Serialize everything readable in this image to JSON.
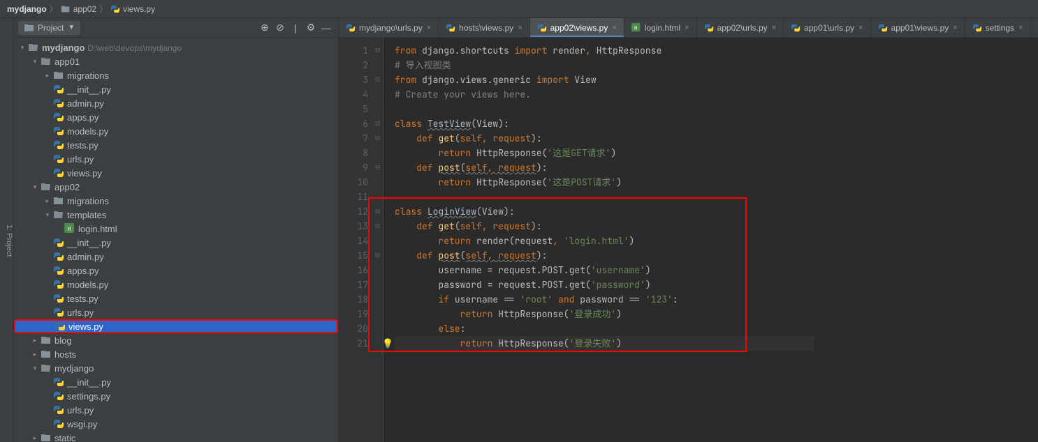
{
  "breadcrumb": {
    "root": "mydjango",
    "mid": "app02",
    "file": "views.py"
  },
  "side_rail": "1: Project",
  "project_panel": {
    "title": "Project",
    "toolbar": {
      "target": "⊕",
      "collapse": "⊘",
      "divider": "|",
      "gear": "⚙",
      "hide": "—"
    }
  },
  "tree": {
    "root": {
      "name": "mydjango",
      "path": "D:\\web\\devops\\mydjango"
    },
    "app01": {
      "name": "app01",
      "migrations": "migrations",
      "files": [
        "__init__.py",
        "admin.py",
        "apps.py",
        "models.py",
        "tests.py",
        "urls.py",
        "views.py"
      ]
    },
    "app02": {
      "name": "app02",
      "migrations": "migrations",
      "templates": "templates",
      "templates_children": [
        "login.html"
      ],
      "files": [
        "__init__.py",
        "admin.py",
        "apps.py",
        "models.py",
        "tests.py",
        "urls.py",
        "views.py"
      ]
    },
    "blog": "blog",
    "hosts": "hosts",
    "mydjango_inner": {
      "name": "mydjango",
      "files": [
        "__init__.py",
        "settings.py",
        "urls.py",
        "wsgi.py"
      ]
    },
    "static": "static"
  },
  "tabs": [
    {
      "label": "mydjango\\urls.py",
      "type": "py"
    },
    {
      "label": "hosts\\views.py",
      "type": "py"
    },
    {
      "label": "app02\\views.py",
      "type": "py",
      "active": true
    },
    {
      "label": "login.html",
      "type": "html"
    },
    {
      "label": "app02\\urls.py",
      "type": "py"
    },
    {
      "label": "app01\\urls.py",
      "type": "py"
    },
    {
      "label": "app01\\views.py",
      "type": "py"
    },
    {
      "label": "settings",
      "type": "py"
    }
  ],
  "code": {
    "line_count": 21,
    "l1": {
      "p1": "from",
      "p2": " django.shortcuts ",
      "p3": "import",
      "p4": " render",
      "p5": ",",
      "p6": " HttpResponse"
    },
    "l2": "# 导入视图类",
    "l3": {
      "p1": "from",
      "p2": " django.views.generic ",
      "p3": "import",
      "p4": " View"
    },
    "l4": "# Create your views here.",
    "l6": {
      "p1": "class ",
      "p2": "TestView",
      "p3": "(View):"
    },
    "l7": {
      "p1": "    def ",
      "p2": "get",
      "p3": "(",
      "p4": "self, request",
      "p5": "):"
    },
    "l8": {
      "p1": "        return ",
      "p2": "HttpResponse(",
      "p3": "'这是GET请求'",
      "p4": ")"
    },
    "l9": {
      "p1": "    def ",
      "p2": "post",
      "p3": "(",
      "p4": "self, request",
      "p5": "):"
    },
    "l10": {
      "p1": "        return ",
      "p2": "HttpResponse(",
      "p3": "'这是POST请求'",
      "p4": ")"
    },
    "l12": {
      "p1": "class ",
      "p2": "LoginView",
      "p3": "(View):"
    },
    "l13": {
      "p1": "    def ",
      "p2": "get",
      "p3": "(",
      "p4": "self, request",
      "p5": "):"
    },
    "l14": {
      "p1": "        return ",
      "p2": "render(request",
      "p3": ", ",
      "p4": "'login.html'",
      "p5": ")"
    },
    "l15": {
      "p1": "    def ",
      "p2": "post",
      "p3": "(",
      "p4": "self, request",
      "p5": "):"
    },
    "l16": {
      "p1": "        username = request.POST.get(",
      "p2": "'username'",
      "p3": ")"
    },
    "l17": {
      "p1": "        password = request.POST.get(",
      "p2": "'password'",
      "p3": ")"
    },
    "l18": {
      "p1": "        if ",
      "p2": "username == ",
      "p3": "'root'",
      "p4": " and ",
      "p5": "password == ",
      "p6": "'123'",
      "p7": ":"
    },
    "l19": {
      "p1": "            return ",
      "p2": "HttpResponse(",
      "p3": "'登录成功'",
      "p4": ")"
    },
    "l20": {
      "p1": "        else",
      "p2": ":"
    },
    "l21": {
      "p1": "            return ",
      "p2": "HttpResponse(",
      "p3": "'登录失败'",
      "p4": ")"
    }
  }
}
